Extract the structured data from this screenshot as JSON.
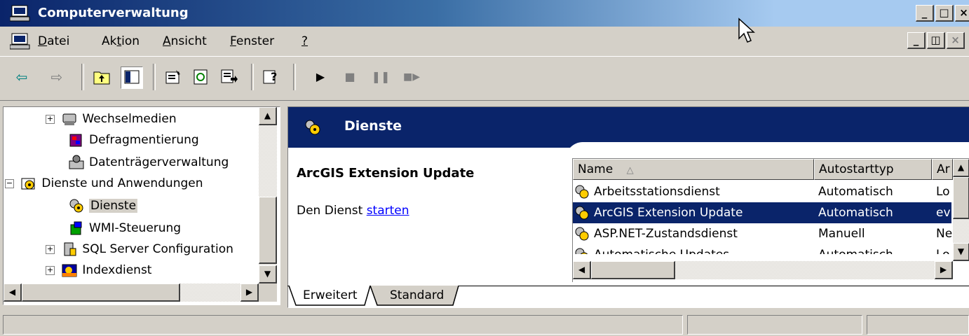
{
  "window": {
    "title": "Computerverwaltung"
  },
  "menu": {
    "items": [
      {
        "label": "Datei",
        "underline": "D",
        "rest": "atei"
      },
      {
        "label": "Aktion",
        "pre": "Ak",
        "underline": "t",
        "rest": "ion"
      },
      {
        "label": "Ansicht",
        "underline": "A",
        "rest": "nsicht"
      },
      {
        "label": "Fenster",
        "underline": "F",
        "rest": "enster"
      },
      {
        "label": "?",
        "underline": "?",
        "rest": ""
      }
    ]
  },
  "tree": {
    "items": [
      {
        "label": "Wechselmedien",
        "icon": "removable-media-icon"
      },
      {
        "label": "Defragmentierung",
        "icon": "defrag-icon"
      },
      {
        "label": "Datenträgerverwaltung",
        "icon": "disk-management-icon"
      },
      {
        "label": "Dienste und Anwendungen",
        "icon": "services-apps-icon"
      },
      {
        "label": "Dienste",
        "icon": "services-gear-icon"
      },
      {
        "label": "WMI-Steuerung",
        "icon": "wmi-icon"
      },
      {
        "label": "SQL Server Configuration",
        "icon": "sql-server-icon"
      },
      {
        "label": "Indexdienst",
        "icon": "index-service-icon"
      }
    ]
  },
  "pane": {
    "header": "Dienste",
    "selected_service": "ArcGIS Extension Update",
    "action_prefix": "Den Dienst",
    "action_link": "starten"
  },
  "list": {
    "columns": [
      {
        "label": "Name",
        "sort": "ascending"
      },
      {
        "label": "Autostarttyp"
      },
      {
        "label": "Ar"
      }
    ],
    "rows": [
      {
        "name": "Arbeitsstationsdienst",
        "startup": "Automatisch",
        "account": "Lo"
      },
      {
        "name": "ArcGIS Extension Update",
        "startup": "Automatisch",
        "account": "ev",
        "selected": true
      },
      {
        "name": "ASP.NET-Zustandsdienst",
        "startup": "Manuell",
        "account": "Ne"
      },
      {
        "name": "Automatische Updates",
        "startup": "Automatisch",
        "account": "Lo"
      }
    ]
  },
  "tabs": [
    {
      "label": "Erweitert",
      "active": true
    },
    {
      "label": "Standard",
      "active": false
    }
  ],
  "colors": {
    "accent": "#0a246a",
    "face": "#d4d0c8",
    "link": "#0000ff"
  }
}
